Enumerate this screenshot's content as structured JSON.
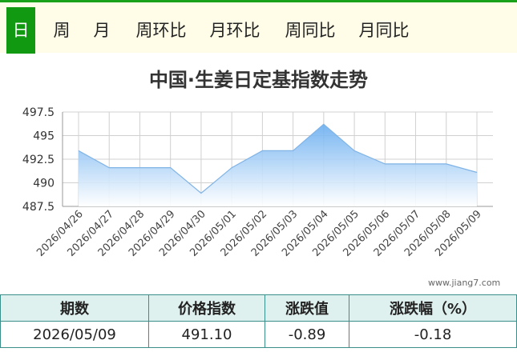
{
  "tabs": [
    {
      "label": "日",
      "active": true
    },
    {
      "label": "周",
      "active": false
    },
    {
      "label": "月",
      "active": false
    },
    {
      "label": "周环比",
      "active": false
    },
    {
      "label": "月环比",
      "active": false
    },
    {
      "label": "周同比",
      "active": false
    },
    {
      "label": "月同比",
      "active": false
    }
  ],
  "watermark": "www.jiang7.com",
  "colors": {
    "accent": "#119911",
    "line": "#7fb3e6",
    "fill_top": "#6aaef0",
    "fill_bottom": "#ffffff"
  },
  "chart_data": {
    "type": "area",
    "title": "中国·生姜日定基指数走势",
    "x": [
      "2026/04/26",
      "2026/04/27",
      "2026/04/28",
      "2026/04/29",
      "2026/04/30",
      "2026/05/01",
      "2026/05/02",
      "2026/05/03",
      "2026/05/04",
      "2026/05/05",
      "2026/05/06",
      "2026/05/07",
      "2026/05/08",
      "2026/05/09"
    ],
    "series": [
      {
        "values": [
          493.4,
          491.6,
          491.6,
          491.6,
          488.9,
          491.6,
          493.4,
          493.4,
          496.2,
          493.4,
          492.0,
          492.0,
          492.0,
          491.1
        ]
      }
    ],
    "yticks": [
      "497.5",
      "495",
      "492.5",
      "490",
      "487.5"
    ],
    "ylim": [
      487.5,
      497.5
    ],
    "grid": true
  },
  "table": {
    "headers": [
      "期数",
      "价格指数",
      "涨跌值",
      "涨跌幅（%）"
    ],
    "row": [
      "2026/05/09",
      "491.10",
      "-0.89",
      "-0.18"
    ]
  }
}
